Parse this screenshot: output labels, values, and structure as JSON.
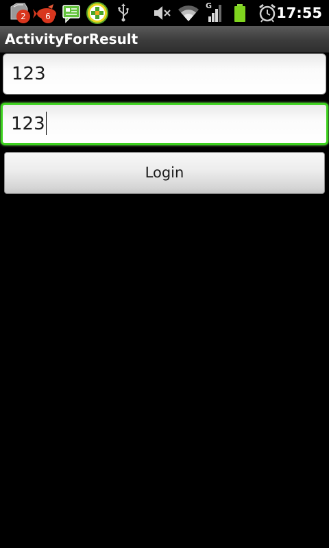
{
  "status_bar": {
    "notifications": [
      {
        "icon": "notification-app-icon",
        "badge": "2"
      },
      {
        "icon": "notification-fish-icon",
        "badge": "6"
      },
      {
        "icon": "message-icon"
      },
      {
        "icon": "security-plus-icon"
      },
      {
        "icon": "usb-icon"
      }
    ],
    "system_icons": [
      "mute-icon",
      "wifi-icon",
      "signal-icon",
      "battery-icon",
      "alarm-icon"
    ],
    "network_type": "G",
    "time": "17:55",
    "colors": {
      "badge": "#d9361e",
      "battery": "#7fd41e",
      "message_icon": "#62c23a"
    }
  },
  "title_bar": {
    "title": "ActivityForResult"
  },
  "form": {
    "username_value": "123",
    "password_value": "123",
    "login_label": "Login",
    "focus_color": "#3cd11e"
  }
}
